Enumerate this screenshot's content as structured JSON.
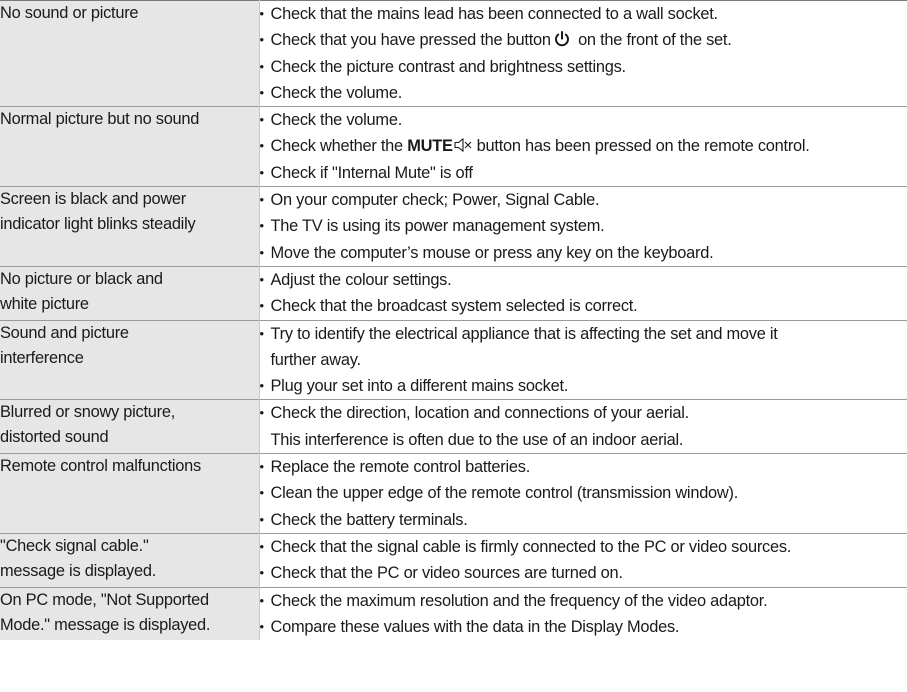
{
  "rows": [
    {
      "symptom": [
        "No sound or picture"
      ],
      "lines": [
        {
          "bullet": true,
          "text": "Check that the mains lead has been connected to a wall socket."
        },
        {
          "bullet": true,
          "pre": "Check that you have pressed the button",
          "icon": "power-icon",
          "post": " on the front of the set."
        },
        {
          "bullet": true,
          "text": "Check the picture contrast and brightness settings."
        },
        {
          "bullet": true,
          "text": "Check the volume."
        }
      ]
    },
    {
      "symptom": [
        "Normal picture but no sound"
      ],
      "lines": [
        {
          "bullet": true,
          "text": "Check the volume."
        },
        {
          "bullet": true,
          "pre": "Check whether the ",
          "bold": "MUTE",
          "icon": "mute-icon",
          "post": "button has been pressed on the remote control."
        },
        {
          "bullet": true,
          "text": "Check if \"Internal Mute\" is off"
        }
      ]
    },
    {
      "symptom": [
        "Screen is black and power",
        "indicator light blinks steadily"
      ],
      "lines": [
        {
          "bullet": true,
          "text": "On your computer check; Power, Signal Cable."
        },
        {
          "bullet": true,
          "text": "The TV is using its power management system."
        },
        {
          "bullet": true,
          "text": "Move the computer’s mouse or press any key on the keyboard."
        }
      ]
    },
    {
      "symptom": [
        "No picture or black and",
        "white picture"
      ],
      "lines": [
        {
          "bullet": true,
          "text": "Adjust the colour settings."
        },
        {
          "bullet": true,
          "text": "Check that the broadcast system selected is correct."
        }
      ]
    },
    {
      "symptom": [
        "Sound and picture",
        "interference"
      ],
      "lines": [
        {
          "bullet": true,
          "text": "Try to identify the electrical appliance that is affecting the set and move it"
        },
        {
          "bullet": false,
          "text": "further away."
        },
        {
          "bullet": true,
          "text": "Plug your set into a different mains socket."
        }
      ]
    },
    {
      "symptom": [
        "Blurred or snowy picture,",
        "distorted sound"
      ],
      "lines": [
        {
          "bullet": true,
          "text": "Check the direction, location and connections of your aerial."
        },
        {
          "bullet": false,
          "text": "This interference is often due to the use of an indoor aerial."
        }
      ]
    },
    {
      "symptom": [
        "Remote control malfunctions"
      ],
      "lines": [
        {
          "bullet": true,
          "text": "Replace the remote control batteries."
        },
        {
          "bullet": true,
          "text": "Clean the upper edge of the remote control (transmission window)."
        },
        {
          "bullet": true,
          "text": "Check the battery terminals."
        }
      ]
    },
    {
      "symptom": [
        "\"Check signal cable.\"",
        "message is displayed."
      ],
      "lines": [
        {
          "bullet": true,
          "text": "Check that the signal cable is firmly connected to the PC or video sources."
        },
        {
          "bullet": true,
          "text": "Check that the PC or video sources are turned on."
        }
      ]
    },
    {
      "symptom": [
        "On PC mode, \"Not Supported",
        "Mode.\" message is displayed."
      ],
      "lines": [
        {
          "bullet": true,
          "text": "Check the maximum resolution and the frequency of the video adaptor."
        },
        {
          "bullet": true,
          "text": "Compare these values with the data in the Display Modes."
        }
      ]
    }
  ],
  "bullet_char": "•",
  "colors": {
    "symptom_bg": "#e6e6e6",
    "rule": "#9a9a9a",
    "text": "#1a1a1a"
  }
}
